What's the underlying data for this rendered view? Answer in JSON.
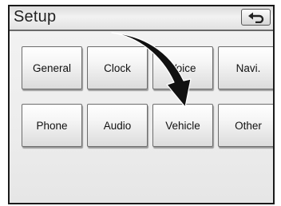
{
  "header": {
    "title": "Setup",
    "back_icon": "back-arrow-icon"
  },
  "buttons": [
    {
      "label": "General"
    },
    {
      "label": "Clock"
    },
    {
      "label": "Voice"
    },
    {
      "label": "Navi."
    },
    {
      "label": "Phone"
    },
    {
      "label": "Audio"
    },
    {
      "label": "Vehicle"
    },
    {
      "label": "Other"
    }
  ],
  "annotation": {
    "icon": "pointer-arrow-icon",
    "points_to": "Vehicle",
    "color": "#111111"
  }
}
